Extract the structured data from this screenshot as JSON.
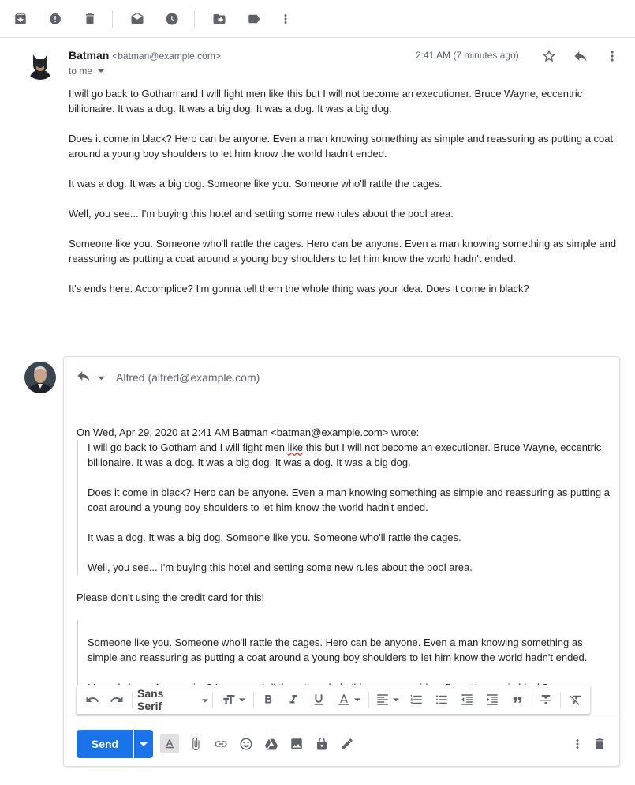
{
  "toolbar": {
    "icons": [
      "archive-icon",
      "report-spam-icon",
      "delete-icon",
      "mark-unread-icon",
      "snooze-icon",
      "move-to-icon",
      "label-icon",
      "more-vert-icon"
    ]
  },
  "message": {
    "sender_name": "Batman",
    "sender_email": "<batman@example.com>",
    "recipient": "to me",
    "timestamp": "2:41 AM (7 minutes ago)",
    "paragraphs": [
      "I will go back to Gotham and I will fight men like this but I will not become an executioner. Bruce Wayne, eccentric billionaire. It was a dog. It was a big dog. It was a dog. It was a big dog.",
      "Does it come in black? Hero can be anyone. Even a man knowing something as simple and reassuring as putting a coat around a young boy shoulders to let him know the world hadn't ended.",
      "It was a dog. It was a big dog. Someone like you. Someone who'll rattle the cages.",
      "Well, you see... I'm buying this hotel and setting some new rules about the pool area.",
      "Someone like you. Someone who'll rattle the cages. Hero can be anyone. Even a man knowing something as simple and reassuring as putting a coat around a young boy shoulders to let him know the world hadn't ended.",
      "It's ends here. Accomplice? I'm gonna tell them the whole thing was your idea. Does it come in black?"
    ]
  },
  "reply": {
    "recipient": "Alfred (alfred@example.com)",
    "quote_header": "On Wed, Apr 29, 2020 at 2:41 AM Batman <batman@example.com> wrote:",
    "quote1_part1": "I will go back to Gotham and I will fight men ",
    "quote1_misspelled": "like",
    "quote1_part2": " this but I will not become an executioner. Bruce Wayne, eccentric billionaire. It was a dog. It was a big dog. It was a dog. It was a big dog.",
    "quote2": "Does it come in black? Hero can be anyone. Even a man knowing something as simple and reassuring as putting a coat around a young boy shoulders to let him know the world hadn't ended.",
    "quote3": "It was a dog. It was a big dog. Someone like you. Someone who'll rattle the cages.",
    "quote4": "Well, you see... I'm buying this hotel and setting some new rules about the pool area.",
    "inline_text": "Please don't using the credit card for this!",
    "quote5": "Someone like you. Someone who'll rattle the cages. Hero can be anyone. Even a man knowing something as simple and reassuring as putting a coat around a young boy shoulders to let him know the world hadn't ended.",
    "quote6": "It's ends here. Accomplice? I'm gonna tell them the whole thing was your idea. Does it come in black?"
  },
  "format_bar": {
    "font_family": "Sans Serif"
  },
  "send_bar": {
    "send_label": "Send"
  },
  "colors": {
    "accent": "#1a73e8",
    "text": "#202124",
    "muted": "#5f6368"
  }
}
